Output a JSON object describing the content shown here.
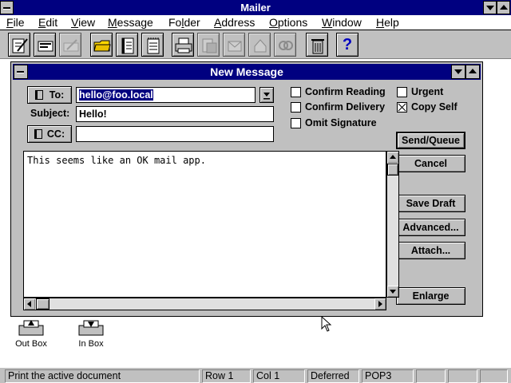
{
  "app": {
    "title": "Mailer"
  },
  "menu": [
    "File",
    "Edit",
    "View",
    "Message",
    "Folder",
    "Address",
    "Options",
    "Window",
    "Help"
  ],
  "toolbar": {
    "buttons": [
      {
        "icon": "compose-icon"
      },
      {
        "icon": "reply-icon"
      },
      {
        "icon": "forward-icon"
      },
      {
        "icon": "open-folder-icon"
      },
      {
        "icon": "address-book-icon"
      },
      {
        "icon": "notepad-icon"
      },
      {
        "icon": "print-icon"
      },
      {
        "icon": "move-icon"
      },
      {
        "icon": "send-receive-icon"
      },
      {
        "icon": "mailbox-icon"
      },
      {
        "icon": "attach-icon"
      },
      {
        "icon": "trash-icon"
      },
      {
        "icon": "help-icon",
        "label": "?"
      }
    ]
  },
  "window": {
    "title": "New Message",
    "to_button": "To:",
    "to_value": "hello@foo.local",
    "subject_label": "Subject:",
    "subject_value": "Hello!",
    "cc_button": "CC:",
    "cc_value": "",
    "options": [
      {
        "label": "Confirm Reading",
        "checked": false
      },
      {
        "label": "Confirm Delivery",
        "checked": false
      },
      {
        "label": "Omit Signature",
        "checked": false
      }
    ],
    "urgent": {
      "label": "Urgent",
      "checked": false
    },
    "copy_self": {
      "label": "Copy Self",
      "checked": true
    },
    "buttons": {
      "send": "Send/Queue",
      "cancel": "Cancel",
      "save_draft": "Save Draft",
      "advanced": "Advanced...",
      "attach": "Attach...",
      "enlarge": "Enlarge"
    },
    "body": "This seems like an OK mail app."
  },
  "desktop_icons": [
    {
      "label": "Out Box",
      "icon": "outbox-icon"
    },
    {
      "label": "In Box",
      "icon": "inbox-icon"
    }
  ],
  "status": {
    "message": "Print the active document",
    "row": "Row 1",
    "col": "Col  1",
    "mode": "Deferred",
    "protocol": "POP3"
  }
}
